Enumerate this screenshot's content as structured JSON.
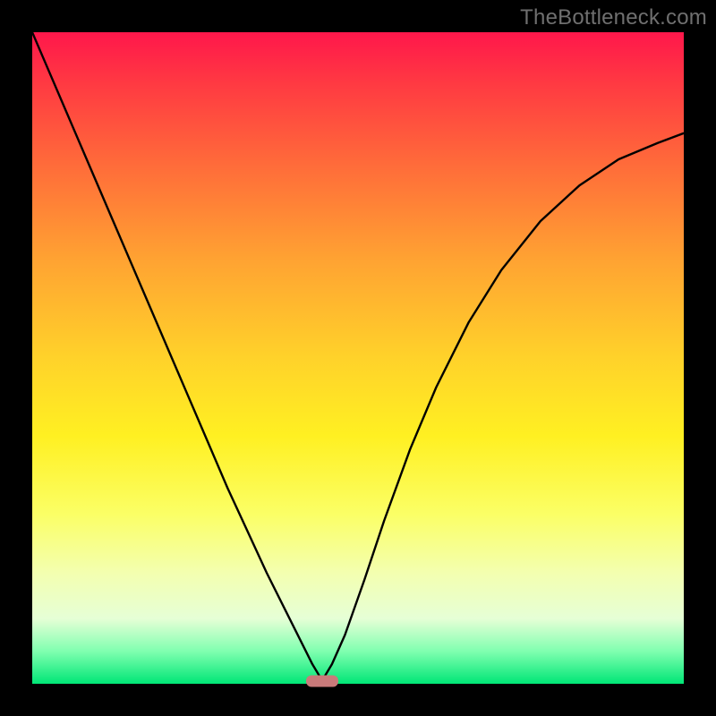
{
  "watermark": "TheBottleneck.com",
  "marker": {
    "x_fraction": 0.445,
    "y_fraction": 0.996
  },
  "chart_data": {
    "type": "line",
    "title": "",
    "xlabel": "",
    "ylabel": "",
    "xlim": [
      0,
      1
    ],
    "ylim": [
      0,
      1
    ],
    "note": "Axes have no visible tick labels; x and y are normalized fractions of the plot area. The curve represents bottleneck percentage vs. component balance, reaching ~0 at x≈0.445.",
    "series": [
      {
        "name": "bottleneck-curve",
        "x": [
          0.0,
          0.03,
          0.06,
          0.09,
          0.12,
          0.15,
          0.18,
          0.21,
          0.24,
          0.27,
          0.3,
          0.33,
          0.36,
          0.39,
          0.415,
          0.43,
          0.445,
          0.46,
          0.48,
          0.51,
          0.54,
          0.58,
          0.62,
          0.67,
          0.72,
          0.78,
          0.84,
          0.9,
          0.96,
          1.0
        ],
        "y": [
          1.0,
          0.93,
          0.86,
          0.79,
          0.72,
          0.65,
          0.58,
          0.51,
          0.44,
          0.37,
          0.3,
          0.235,
          0.17,
          0.11,
          0.06,
          0.03,
          0.005,
          0.03,
          0.075,
          0.16,
          0.25,
          0.36,
          0.455,
          0.555,
          0.635,
          0.71,
          0.765,
          0.805,
          0.83,
          0.845
        ]
      }
    ],
    "gradient_colors_top_to_bottom": [
      "#ff174b",
      "#ff6a3a",
      "#ffd22a",
      "#fbff66",
      "#00e676"
    ]
  }
}
